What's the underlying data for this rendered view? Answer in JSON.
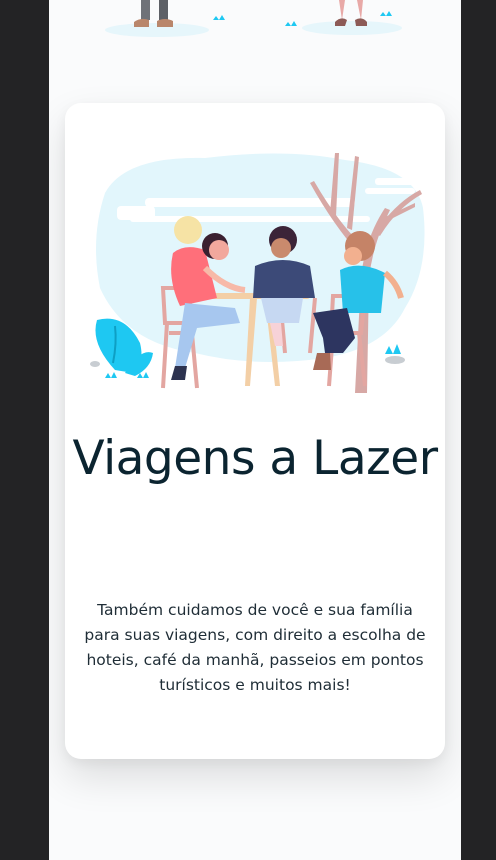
{
  "card": {
    "title": "Viagens a Lazer",
    "text": "Também cuidamos de você e sua família para suas viagens, com direito a escolha de hoteis, café da manhã, passeios em pontos turísticos e muitos mais!",
    "illustration_icon": "friends-at-cafe-table-illustration"
  },
  "top_illustration_icon": "people-standing-illustration",
  "colors": {
    "accent": "#1ec8f2",
    "title": "#0b2430",
    "text": "#1f2d36",
    "background": "#232325",
    "page": "#fafbfc"
  }
}
